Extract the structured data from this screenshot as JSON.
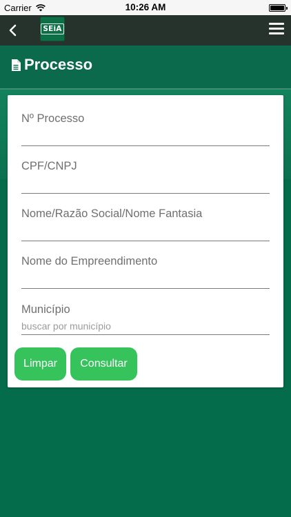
{
  "status_bar": {
    "carrier": "Carrier",
    "time": "10:26 AM",
    "battery_level": 1.0
  },
  "app_bar": {
    "logo_text": "SEiA",
    "back_icon": "chevron-left-icon",
    "menu_icon": "hamburger-menu-icon"
  },
  "header": {
    "icon": "document-icon",
    "title": "Processo"
  },
  "form": {
    "fields": [
      {
        "label": "Nº Processo",
        "value": "",
        "placeholder": ""
      },
      {
        "label": "CPF/CNPJ",
        "value": "",
        "placeholder": ""
      },
      {
        "label": "Nome/Razão Social/Nome Fantasia",
        "value": "",
        "placeholder": ""
      },
      {
        "label": "Nome do Empreendimento",
        "value": "",
        "placeholder": ""
      },
      {
        "label": "Município",
        "value": "",
        "placeholder": "buscar por município"
      }
    ],
    "buttons": {
      "clear_label": "Limpar",
      "search_label": "Consultar"
    }
  },
  "colors": {
    "app_bar": "#26332d",
    "header": "#0a6a4b",
    "background": "#046b4b",
    "button": "#36c35c"
  }
}
